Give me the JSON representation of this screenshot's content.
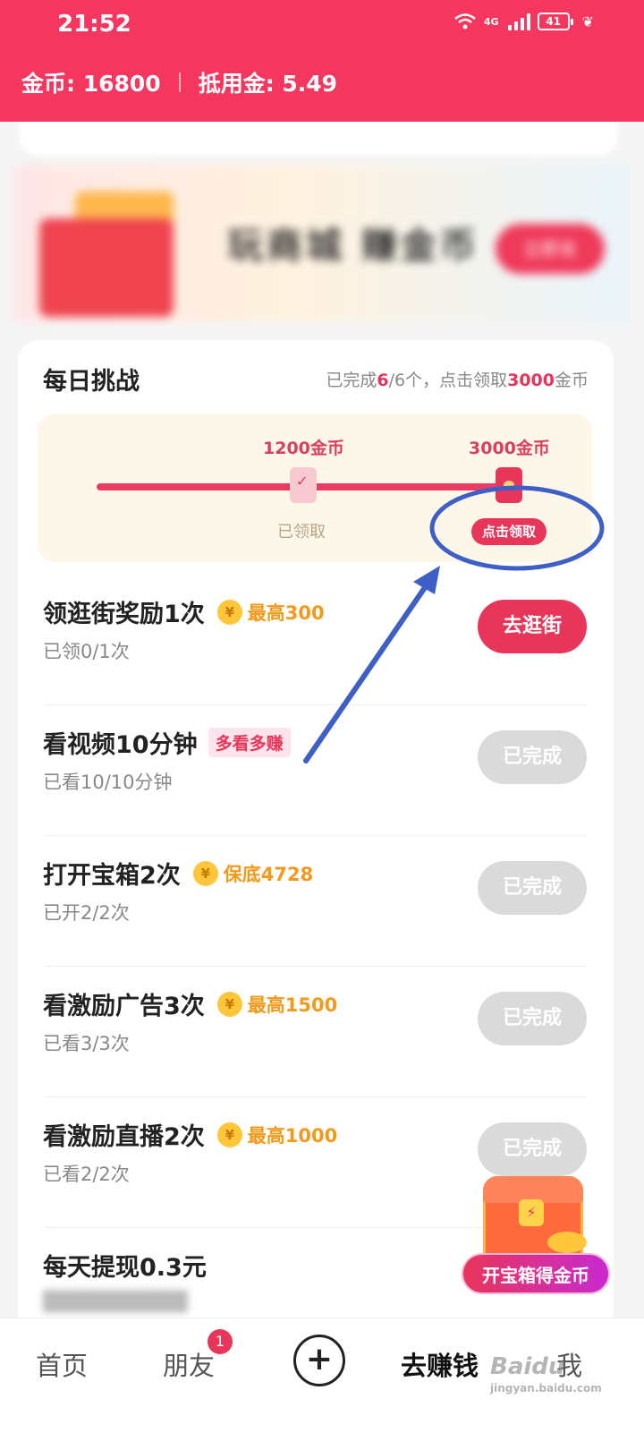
{
  "status_bar": {
    "time": "21:52",
    "network": "4G",
    "battery": "41"
  },
  "header": {
    "coins_label": "金币: 16800",
    "deduct_label": "抵用金: 5.49"
  },
  "banner": {
    "title": "玩商城 赚金币",
    "subtitle": "",
    "button": "立即去"
  },
  "challenge": {
    "title": "每日挑战",
    "status_prefix": "已完成",
    "done": "6",
    "total_part": "/6个，点击领取",
    "reward": "3000",
    "reward_suffix": "金币",
    "milestones": [
      {
        "amount": "1200金币",
        "state": "已领取"
      },
      {
        "amount": "3000金币",
        "state": "点击领取"
      }
    ]
  },
  "tasks": [
    {
      "name": "领逛街奖励1次",
      "reward": "最高300",
      "tag": "",
      "progress": "已领0/1次",
      "button": "去逛街"
    },
    {
      "name": "看视频10分钟",
      "reward": "",
      "tag": "多看多赚",
      "progress": "已看10/10分钟",
      "button": "已完成"
    },
    {
      "name": "打开宝箱2次",
      "reward": "保底4728",
      "tag": "",
      "progress": "已开2/2次",
      "button": "已完成"
    },
    {
      "name": "看激励广告3次",
      "reward": "最高1500",
      "tag": "",
      "progress": "已看3/3次",
      "button": "已完成"
    },
    {
      "name": "看激励直播2次",
      "reward": "最高1000",
      "tag": "",
      "progress": "已看2/2次",
      "button": "已完成"
    },
    {
      "name": "每天提现0.3元",
      "reward": "",
      "tag": "",
      "progress": "",
      "button": ""
    }
  ],
  "coin_icon_glyph": "¥",
  "chest": {
    "label": "开宝箱得金币"
  },
  "bottom_nav": {
    "home": "首页",
    "friends": "朋友",
    "friends_badge": "1",
    "plus": "+",
    "earn": "去赚钱",
    "me": "我"
  },
  "watermark": {
    "brand": "Baidu",
    "sub": "jingyan.baidu.com"
  },
  "colors": {
    "brand": "#f5365e",
    "accent": "#e8355a",
    "reward": "#f19a1b",
    "annotation": "#3e5fc6"
  }
}
